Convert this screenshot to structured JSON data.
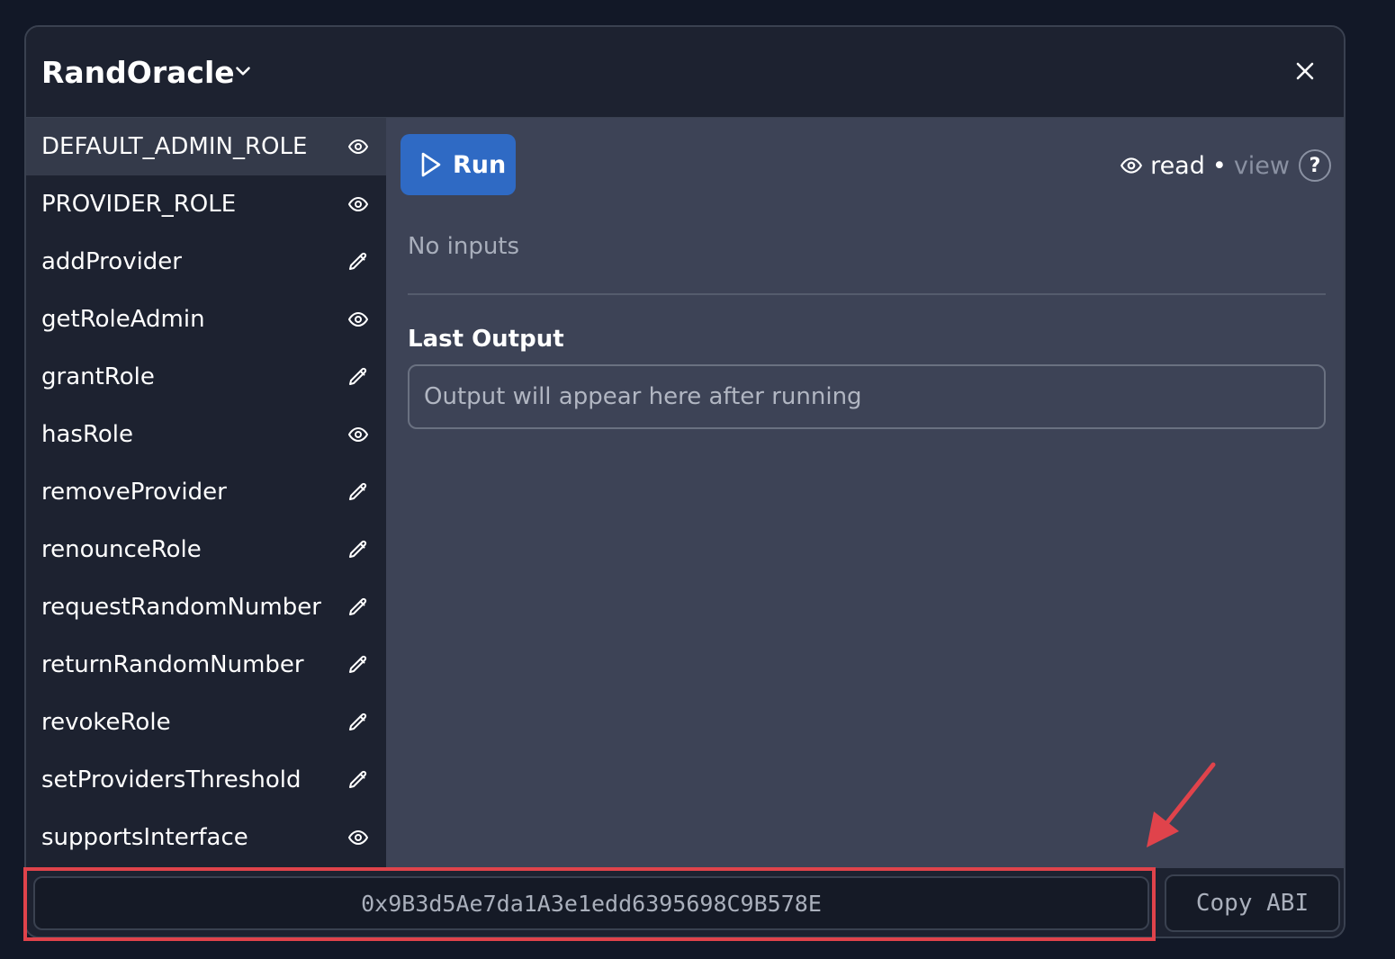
{
  "header": {
    "contract_name": "RandOracle"
  },
  "sidebar": {
    "items": [
      {
        "label": "DEFAULT_ADMIN_ROLE",
        "icon": "eye-icon",
        "active": true
      },
      {
        "label": "PROVIDER_ROLE",
        "icon": "eye-icon",
        "active": false
      },
      {
        "label": "addProvider",
        "icon": "pencil-icon",
        "active": false
      },
      {
        "label": "getRoleAdmin",
        "icon": "eye-icon",
        "active": false
      },
      {
        "label": "grantRole",
        "icon": "pencil-icon",
        "active": false
      },
      {
        "label": "hasRole",
        "icon": "eye-icon",
        "active": false
      },
      {
        "label": "removeProvider",
        "icon": "pencil-icon",
        "active": false
      },
      {
        "label": "renounceRole",
        "icon": "pencil-icon",
        "active": false
      },
      {
        "label": "requestRandomNumber",
        "icon": "pencil-icon",
        "active": false
      },
      {
        "label": "returnRandomNumber",
        "icon": "pencil-icon",
        "active": false
      },
      {
        "label": "revokeRole",
        "icon": "pencil-icon",
        "active": false
      },
      {
        "label": "setProvidersThreshold",
        "icon": "pencil-icon",
        "active": false
      },
      {
        "label": "supportsInterface",
        "icon": "eye-icon",
        "active": false
      }
    ]
  },
  "main": {
    "run_label": "Run",
    "mode": {
      "read": "read",
      "separator": "•",
      "view": "view",
      "help": "?"
    },
    "no_inputs": "No inputs",
    "last_output_label": "Last Output",
    "output_placeholder": "Output will appear here after running"
  },
  "footer": {
    "address": "0x9B3d5Ae7da1A3e1edd6395698C9B578E",
    "copy_abi_label": "Copy ABI"
  },
  "colors": {
    "page_bg": "#121827",
    "panel_bg": "#1d2230",
    "main_bg": "#3d4356",
    "active_item_bg": "#343a4a",
    "accent_blue": "#2f6ac4",
    "annotation_red": "#e0434b"
  }
}
